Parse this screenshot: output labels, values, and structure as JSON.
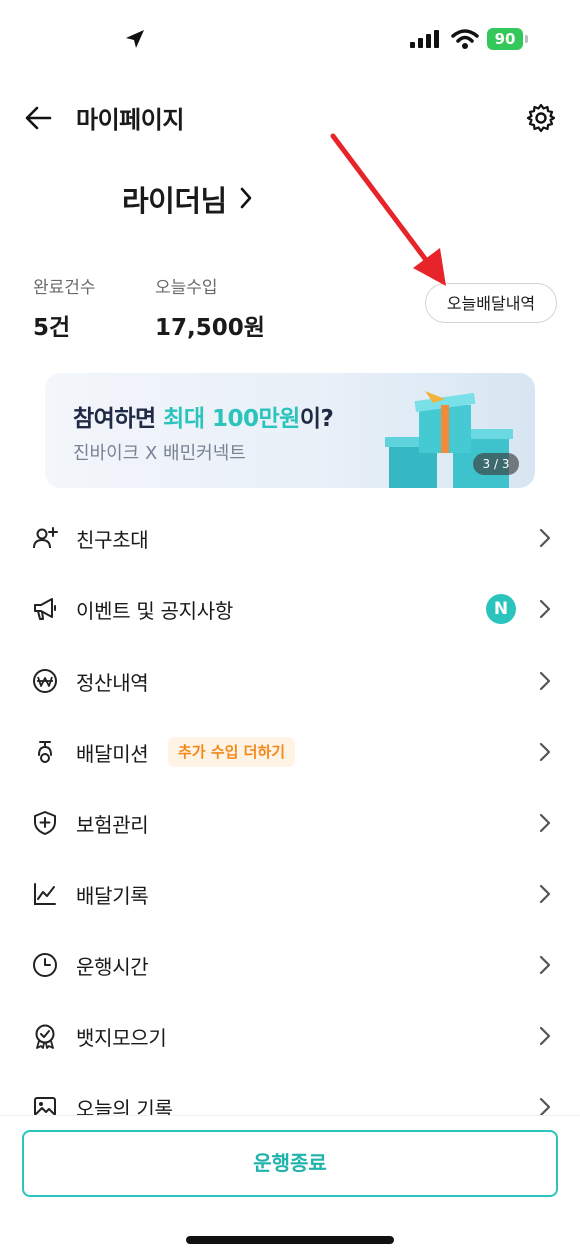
{
  "status_bar": {
    "battery": "90"
  },
  "header": {
    "title": "마이페이지"
  },
  "profile": {
    "name": "라이더님"
  },
  "stats": {
    "completed_label": "완료건수",
    "completed_value": "5건",
    "income_label": "오늘수입",
    "income_value": "17,500원"
  },
  "today_history_button": "오늘배달내역",
  "banner": {
    "title_pre": "참여하면 ",
    "title_highlight": "최대 100만원",
    "title_post": "이?",
    "subtitle": "진바이크 X 배민커넥트",
    "counter": "3 / 3"
  },
  "menu": [
    {
      "label": "친구초대",
      "icon": "person-add-icon"
    },
    {
      "label": "이벤트 및 공지사항",
      "icon": "megaphone-icon",
      "badge": "N"
    },
    {
      "label": "정산내역",
      "icon": "won-circle-icon"
    },
    {
      "label": "배달미션",
      "icon": "scooter-icon",
      "tag": "추가 수입 더하기"
    },
    {
      "label": "보험관리",
      "icon": "shield-plus-icon"
    },
    {
      "label": "배달기록",
      "icon": "line-chart-icon"
    },
    {
      "label": "운행시간",
      "icon": "clock-icon"
    },
    {
      "label": "뱃지모으기",
      "icon": "badge-medal-icon"
    },
    {
      "label": "오늘의 기록",
      "icon": "image-icon"
    }
  ],
  "end_button": "운행종료",
  "colors": {
    "accent": "#2bc4bd",
    "tag_text": "#f28a1c",
    "tag_bg": "#fff3e6",
    "annotation_arrow": "#e8242b"
  }
}
